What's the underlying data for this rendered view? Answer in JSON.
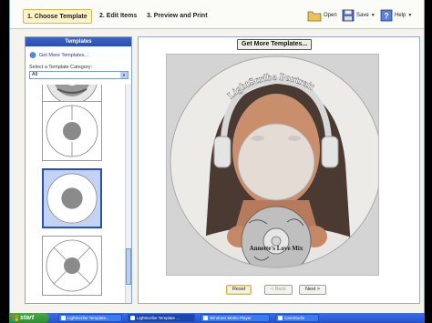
{
  "steps": [
    {
      "label": "1. Choose Template"
    },
    {
      "label": "2. Edit Items"
    },
    {
      "label": "3. Preview and Print"
    }
  ],
  "toolbar": {
    "open_label": "Open",
    "save_label": "Save",
    "help_label": "Help"
  },
  "templates_panel": {
    "header": "Templates",
    "get_more_link": "Get More Templates...",
    "category_label": "Select a Template Category:",
    "category_value": "All"
  },
  "main": {
    "get_more_button": "Get More Templates...",
    "disc_title": "LightScribe Portrait",
    "disc_label": "Annette's Love Mix"
  },
  "nav": {
    "reset_label": "Reset",
    "back_label": "< Back",
    "next_label": "Next >"
  },
  "taskbar": {
    "start_label": "start",
    "tasks": [
      {
        "label": "LightScribe Template..."
      },
      {
        "label": "LightScribe Template ..."
      },
      {
        "label": "Windows Media Player"
      },
      {
        "label": "CamStudio"
      }
    ]
  },
  "colors": {
    "accent": "#2d4fb3",
    "taskbar": "#2451c9",
    "start": "#2e8a2e"
  }
}
